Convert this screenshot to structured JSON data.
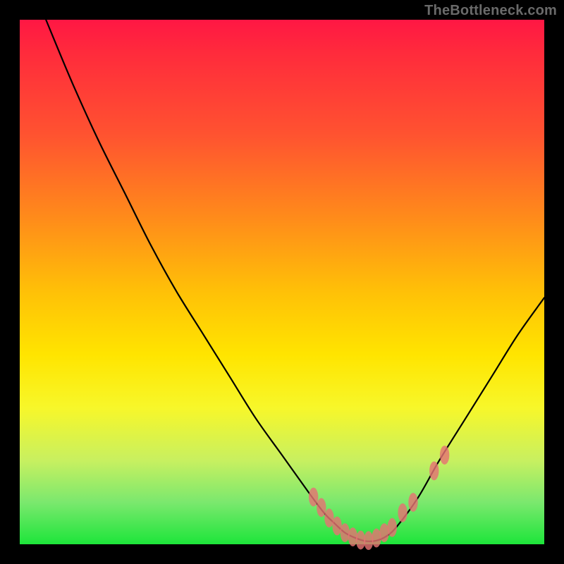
{
  "watermark": "TheBottleneck.com",
  "chart_data": {
    "type": "line",
    "title": "",
    "xlabel": "",
    "ylabel": "",
    "xlim": [
      0,
      100
    ],
    "ylim": [
      0,
      100
    ],
    "grid": false,
    "legend": false,
    "annotations": [],
    "series": [
      {
        "name": "bottleneck-curve",
        "x": [
          5,
          10,
          15,
          20,
          25,
          30,
          35,
          40,
          45,
          50,
          55,
          58,
          60,
          62,
          64,
          66,
          68,
          70,
          72,
          76,
          80,
          85,
          90,
          95,
          100
        ],
        "y": [
          100,
          88,
          77,
          67,
          57,
          48,
          40,
          32,
          24,
          17,
          10,
          6,
          4,
          2.2,
          1.2,
          0.6,
          0.7,
          1.6,
          3.5,
          9,
          16,
          24,
          32,
          40,
          47
        ],
        "color": "#000000"
      }
    ],
    "markers": {
      "name": "near-trough-points",
      "color": "#e57373",
      "x": [
        56,
        57.5,
        59,
        60.5,
        62,
        63.5,
        65,
        66.5,
        68,
        69.5,
        71,
        73,
        75,
        79,
        81
      ],
      "y": [
        9,
        7,
        5,
        3.5,
        2.2,
        1.4,
        0.8,
        0.7,
        1.2,
        2.2,
        3.2,
        6,
        8,
        14,
        17
      ]
    },
    "background_gradient": {
      "orientation": "vertical",
      "stops": [
        {
          "pos": 0.0,
          "color": "#ff1744"
        },
        {
          "pos": 0.22,
          "color": "#ff5330"
        },
        {
          "pos": 0.38,
          "color": "#ff8c1a"
        },
        {
          "pos": 0.52,
          "color": "#ffc107"
        },
        {
          "pos": 0.64,
          "color": "#ffe500"
        },
        {
          "pos": 0.84,
          "color": "#c8f060"
        },
        {
          "pos": 1.0,
          "color": "#1de53a"
        }
      ]
    }
  }
}
